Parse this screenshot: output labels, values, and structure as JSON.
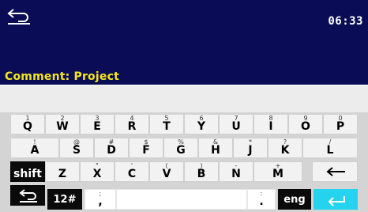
{
  "header": {
    "time": "06:33",
    "field_label": "Comment: Project"
  },
  "input": {
    "value": ""
  },
  "keyboard": {
    "row1": [
      {
        "alt": "1",
        "main": "Q"
      },
      {
        "alt": "2",
        "main": "W"
      },
      {
        "alt": "3",
        "main": "E"
      },
      {
        "alt": "4",
        "main": "R"
      },
      {
        "alt": "5",
        "main": "T"
      },
      {
        "alt": "6",
        "main": "Y"
      },
      {
        "alt": "7",
        "main": "U"
      },
      {
        "alt": "8",
        "main": "I"
      },
      {
        "alt": "9",
        "main": "O"
      },
      {
        "alt": "0",
        "main": "P"
      }
    ],
    "row2": [
      {
        "alt": "!",
        "main": "A"
      },
      {
        "alt": "@",
        "main": "S"
      },
      {
        "alt": "#",
        "main": "D"
      },
      {
        "alt": "$",
        "main": "F"
      },
      {
        "alt": "%",
        "main": "G"
      },
      {
        "alt": "&",
        "main": "H"
      },
      {
        "alt": "*",
        "main": "J"
      },
      {
        "alt": "?",
        "main": "K"
      },
      {
        "alt": "/",
        "main": "L"
      }
    ],
    "row3": [
      {
        "alt": "_",
        "main": "Z"
      },
      {
        "alt": "\"",
        "main": "X"
      },
      {
        "alt": "'",
        "main": "C"
      },
      {
        "alt": "(",
        "main": "V"
      },
      {
        "alt": ")",
        "main": "B"
      },
      {
        "alt": "-",
        "main": "N"
      },
      {
        "alt": "+",
        "main": "M"
      }
    ],
    "shift_label": "shift",
    "mode_label": "12#",
    "comma_alt": ";",
    "comma_main": ",",
    "period_alt": ":",
    "period_main": ".",
    "lang_label": "eng",
    "colors": {
      "header_bg": "#0a0d55",
      "label_yellow": "#f5e61d",
      "enter_cyan": "#25d3ee"
    }
  }
}
